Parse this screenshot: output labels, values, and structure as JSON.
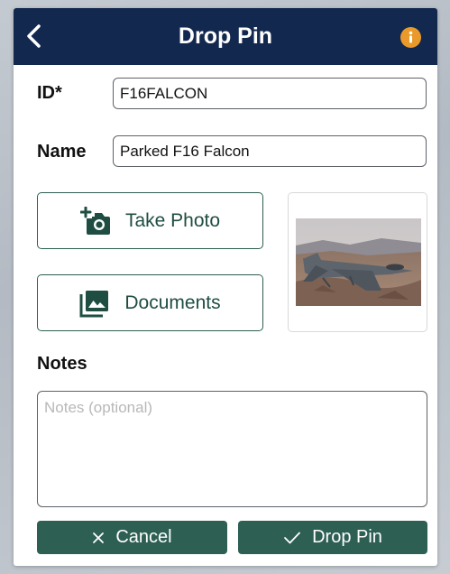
{
  "header": {
    "title": "Drop Pin",
    "back_icon": "chevron-left-icon",
    "info_icon": "info-icon",
    "bar_color": "#13284f",
    "info_color": "#e99a2b"
  },
  "form": {
    "id": {
      "label": "ID*",
      "value": "F16FALCON"
    },
    "name": {
      "label": "Name",
      "value": "Parked F16 Falcon"
    }
  },
  "media": {
    "take_photo": {
      "label": "Take Photo",
      "icon": "add-photo-icon"
    },
    "documents": {
      "label": "Documents",
      "icon": "photo-library-icon"
    },
    "thumbnail_icon": "photo-thumbnail"
  },
  "notes": {
    "label": "Notes",
    "placeholder": "Notes (optional)",
    "value": ""
  },
  "footer": {
    "cancel": {
      "label": "Cancel",
      "icon": "close-icon"
    },
    "drop_pin": {
      "label": "Drop Pin",
      "icon": "check-icon"
    },
    "button_color": "#2d5f53"
  }
}
